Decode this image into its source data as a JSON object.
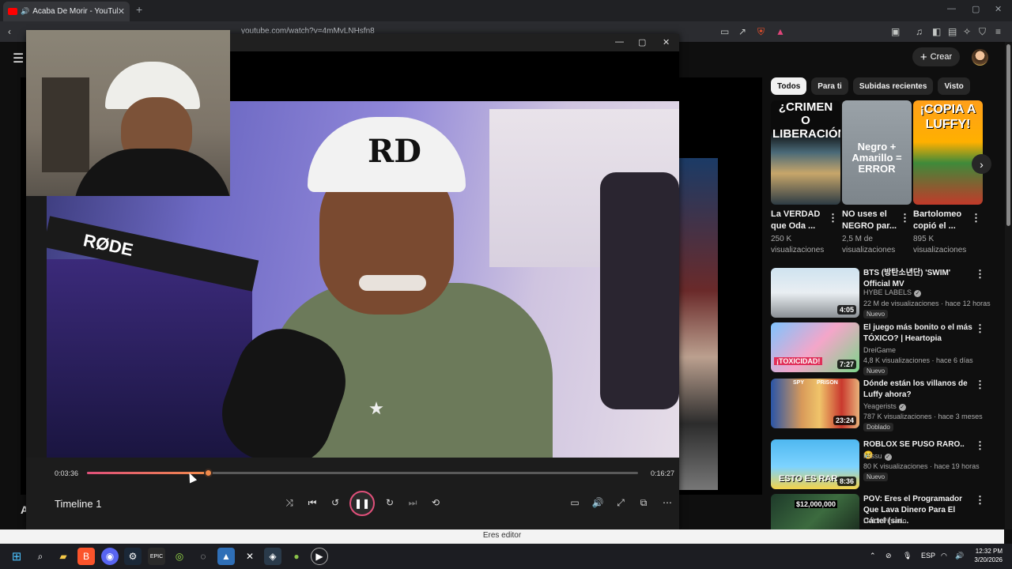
{
  "browser": {
    "tab_title": "Acaba De Morir - YouTube",
    "tab_close": "✕",
    "new_tab": "+",
    "url": "youtube.com/watch?v=4mMvLNHsfn8",
    "window_min": "—",
    "window_max": "▢",
    "window_close": "✕"
  },
  "youtube": {
    "create_label": "Crear",
    "main_title_partial": "Acab",
    "chips": [
      "Todos",
      "Para ti",
      "Subidas recientes",
      "Visto"
    ],
    "shorts": [
      {
        "thumb_text": "¿CRIMEN O LIBERACIÓN?",
        "title": "La VERDAD que Oda ...",
        "meta1": "250 K",
        "meta2": "visualizaciones"
      },
      {
        "thumb_text": "Negro + Amarillo = ERROR",
        "title": "NO uses el NEGRO par...",
        "meta1": "2,5 M de",
        "meta2": "visualizaciones"
      },
      {
        "thumb_text": "¡COPIA A LUFFY!",
        "title": "Bartolomeo copió el ...",
        "meta1": "895 K",
        "meta2": "visualizaciones"
      }
    ],
    "recommendations": [
      {
        "title": "BTS (방탄소년단) 'SWIM' Official MV",
        "channel": "HYBE LABELS",
        "views": "22 M de visualizaciones · hace 12 horas",
        "badge": "Nuevo",
        "duration": "4:05"
      },
      {
        "title": "El juego más bonito o el más TÓXICO? | Heartopia",
        "channel": "DreiGame",
        "views": "4,8 K visualizaciones · hace 6 días",
        "badge": "Nuevo",
        "duration": "7:27",
        "thumb_text": "¡TOXICIDAD!"
      },
      {
        "title": "Dónde están los villanos de Luffy ahora?",
        "channel": "Yeagerists",
        "views": "787 K visualizaciones · hace 3 meses",
        "badge": "Doblado",
        "duration": "23:24",
        "thumb_text1": "SPY",
        "thumb_text2": "PRISON"
      },
      {
        "title": "ROBLOX SE PUSO RARO.. 😢",
        "channel": "Missu",
        "views": "80 K visualizaciones · hace 19 horas",
        "badge": "Nuevo",
        "duration": "8:36",
        "thumb_text": "ESTO ES RAR"
      },
      {
        "title": "POV: Eres el Programador Que Lava Dinero Para El Cártel (sin...",
        "channel": "Dolor Pintado",
        "thumb_text": "$12,000,000"
      }
    ]
  },
  "player": {
    "current_time": "0:03:36",
    "total_time": "0:16:27",
    "progress_fraction": 0.219,
    "timeline_label": "Timeline 1",
    "mic_brand": "RØDE",
    "cap_logo": "RD",
    "min": "—",
    "max": "▢",
    "close": "✕"
  },
  "toast": "Eres editor",
  "taskbar": {
    "lang": "ESP",
    "time": "12:32 PM",
    "date": "3/20/2026"
  },
  "colors": {
    "progress_start": "#e0507a",
    "progress_end": "#f08a4b",
    "youtube_red": "#ff0000"
  }
}
